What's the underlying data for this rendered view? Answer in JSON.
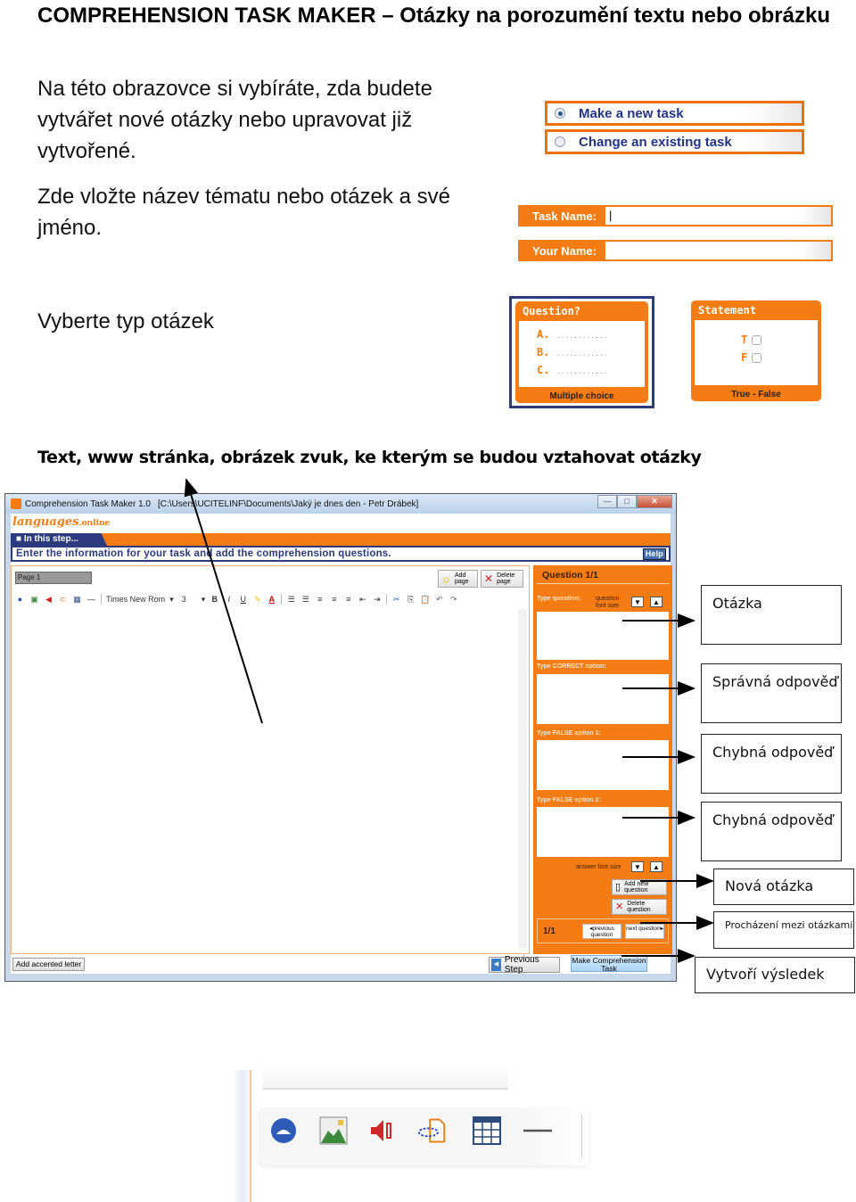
{
  "document": {
    "title": "COMPREHENSION TASK MAKER – Otázky na porozumění textu nebo obrázku",
    "paragraph_1": "Na této obrazovce si vybíráte, zda budete vytvářet nové otázky nebo upravovat již vytvořené.",
    "paragraph_2": "Zde vložte název tématu nebo otázek a své jméno.",
    "paragraph_3": "Vyberte typ otázek",
    "caption": "Text, www stránka, obrázek zvuk, ke kterým se budou vztahovat otázky"
  },
  "task_choice": {
    "options": [
      {
        "label": "Make a new task",
        "selected": true
      },
      {
        "label": "Change an existing task",
        "selected": false
      }
    ]
  },
  "task_fields": {
    "task_name_label": "Task Name:",
    "task_name_value": "|",
    "your_name_label": "Your Name:",
    "your_name_value": ""
  },
  "task_types": [
    {
      "header": "Question?",
      "lines": [
        "A.",
        "B.",
        "C."
      ],
      "dots": "............",
      "footer": "Multiple choice",
      "selected": true
    },
    {
      "header": "Statement",
      "lines": [
        "T",
        "F"
      ],
      "footer": "True - False",
      "selected": false
    }
  ],
  "app_window": {
    "title": "Comprehension Task Maker 1.0",
    "path": "[C:\\Users\\UCITELINF\\Documents\\Jaký je dnes den - Petr Drábek]",
    "window_buttons": {
      "minimize": "—",
      "maximize": "□",
      "close": "✕"
    },
    "logo": "languages",
    "logo_suffix": ".online",
    "step_tab": "■ In this step...",
    "instruction": "Enter the information for your task and add the comprehension questions.",
    "help": "Help",
    "page_field": "Page 1",
    "add_page": "Add page",
    "delete_page": "Delete page",
    "font_name": "Times New Rom",
    "font_size": "3",
    "toolbar_bold": "B",
    "toolbar_italic": "I",
    "toolbar_underline": "U",
    "toolbar_fontcolor": "A",
    "add_accented": "Add accented letter",
    "previous_step": "Previous Step",
    "make_task": "Make Comprehension Task"
  },
  "question_panel": {
    "title": "Question 1/1",
    "type_question": "Type question:",
    "question_font_size": "question font size",
    "correct_label": "Type CORRECT option:",
    "false1_label": "Type FALSE option 1:",
    "false2_label": "Type FALSE option 2:",
    "answer_font_size": "answer font size",
    "add_question": "Add new question",
    "delete_question": "Delete question",
    "counter": "1/1",
    "previous_question": "previous question",
    "next_question": "next question",
    "down_arrow": "▼",
    "up_arrow": "▲"
  },
  "callouts": {
    "question": "Otázka",
    "correct": "Správná odpověď",
    "false1": "Chybná odpověď",
    "false2": "Chybná odpověď",
    "new_question": "Nová otázka",
    "browse": "Procházení mezi otázkami",
    "result": "Vytvoří výsledek"
  },
  "zoomed_toolbar": {
    "icons": [
      "web-link-icon",
      "image-icon",
      "sound-icon",
      "attach-file-icon",
      "table-icon",
      "horizontal-rule-icon"
    ]
  },
  "colors": {
    "accent_orange": "#f47c12",
    "navy": "#2c3b80",
    "option_text": "#223388"
  }
}
